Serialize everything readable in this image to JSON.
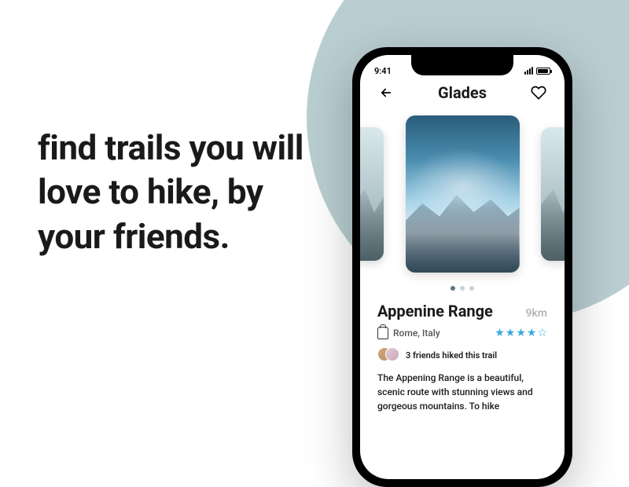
{
  "headline": "find trails you will love to hike, by your friends.",
  "status": {
    "time": "9:41"
  },
  "header": {
    "title": "Glades"
  },
  "carousel": {
    "active_index": 0,
    "count": 3
  },
  "trail": {
    "name": "Appenine Range",
    "distance": "9km",
    "location": "Rome, Italy",
    "rating": 4,
    "rating_max": 5,
    "friends_text": "3 friends hiked this trail",
    "description": "The Appening Range is a beautiful, scenic route with stunning views and gorgeous mountains. To hike"
  }
}
